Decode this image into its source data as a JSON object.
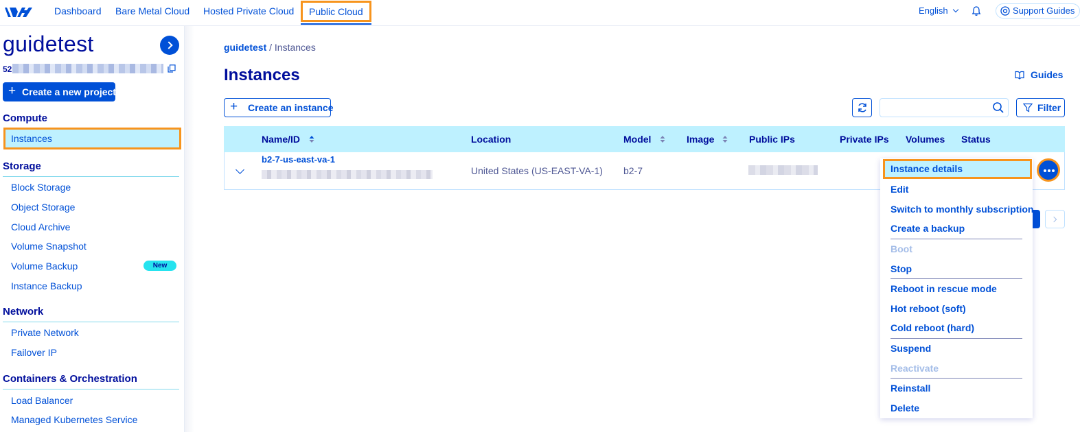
{
  "nav": {
    "items": [
      "Dashboard",
      "Bare Metal Cloud",
      "Hosted Private Cloud",
      "Public Cloud"
    ],
    "language": "English",
    "support": "Support Guides"
  },
  "sidebar": {
    "project_name": "guidetest",
    "project_id_prefix": "52",
    "create_project": "Create a new project",
    "sections": {
      "compute": {
        "title": "Compute",
        "items": [
          "Instances"
        ]
      },
      "storage": {
        "title": "Storage",
        "items": [
          "Block Storage",
          "Object Storage",
          "Cloud Archive",
          "Volume Snapshot",
          "Volume Backup",
          "Instance Backup"
        ],
        "badge": "New"
      },
      "network": {
        "title": "Network",
        "items": [
          "Private Network",
          "Failover IP"
        ]
      },
      "containers": {
        "title": "Containers & Orchestration",
        "items": [
          "Load Balancer",
          "Managed Kubernetes Service"
        ]
      }
    }
  },
  "main": {
    "breadcrumb_project": "guidetest",
    "breadcrumb_sep": "/",
    "breadcrumb_page": "Instances",
    "title": "Instances",
    "guides": "Guides",
    "create_instance": "Create an instance",
    "search_placeholder": "",
    "filter": "Filter",
    "table": {
      "headers": [
        "Name/ID",
        "Location",
        "Model",
        "Image",
        "Public IPs",
        "Private IPs",
        "Volumes",
        "Status"
      ],
      "row": {
        "name": "b2-7-us-east-va-1",
        "location": "United States (US-EAST-VA-1)",
        "model": "b2-7"
      }
    }
  },
  "menu": {
    "items": [
      "Instance details",
      "Edit",
      "Switch to monthly subscription",
      "Create a backup",
      "Boot",
      "Stop",
      "Reboot in rescue mode",
      "Hot reboot (soft)",
      "Cold reboot (hard)",
      "Suspend",
      "Reactivate",
      "Reinstall",
      "Delete"
    ]
  },
  "colors": {
    "brand": "#0050d7",
    "navy": "#000e9c",
    "highlight": "#f7941d",
    "light_blue": "#bef1ff",
    "badge": "#26e3ef"
  }
}
